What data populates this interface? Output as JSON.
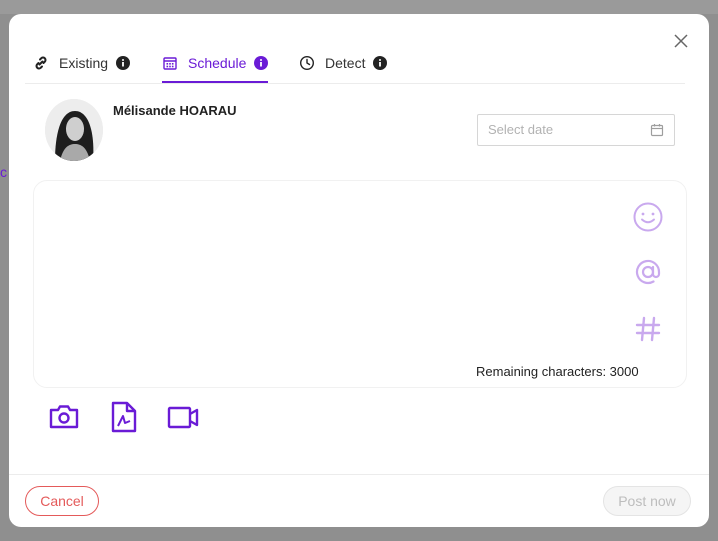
{
  "background": {
    "link_fragment": "c"
  },
  "modal": {
    "close_label": "×",
    "tabs": [
      {
        "label": "Existing",
        "icon": "link-icon",
        "active": false
      },
      {
        "label": "Schedule",
        "icon": "calendar-grid-icon",
        "active": true
      },
      {
        "label": "Detect",
        "icon": "clock-icon",
        "active": false
      }
    ],
    "user": {
      "name": "Mélisande HOARAU"
    },
    "date_picker": {
      "placeholder": "Select date",
      "value": ""
    },
    "editor": {
      "text": "",
      "remaining_characters": "Remaining characters: 3000",
      "tools": [
        "emoji-icon",
        "mention-icon",
        "hashtag-icon"
      ]
    },
    "media_buttons": [
      "camera-icon",
      "pdf-icon",
      "video-icon"
    ],
    "footer": {
      "cancel_label": "Cancel",
      "post_label": "Post now"
    }
  },
  "colors": {
    "accent": "#6a1bd6",
    "accent_light": "#c9a9ee",
    "danger": "#e45a5a",
    "disabled_text": "#bdbdbd"
  }
}
